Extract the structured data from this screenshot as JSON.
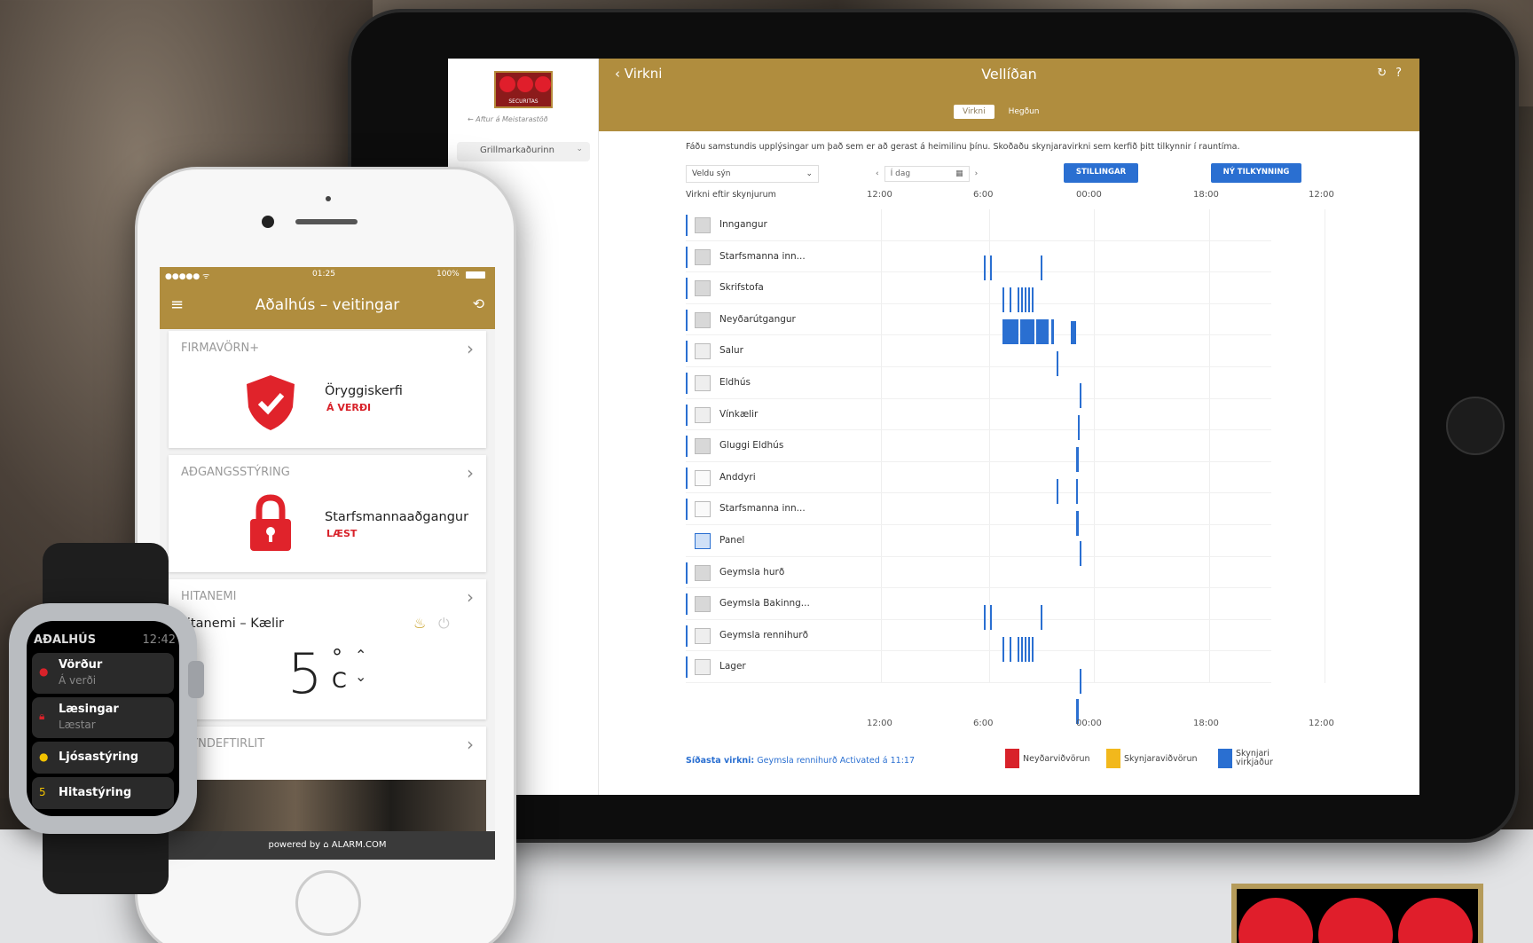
{
  "ipad": {
    "sidebar": {
      "logo_text": "SECURITAS",
      "back_link": "← Aftur á Meistarastöð",
      "site_select": "Grillmarkaðurinn"
    },
    "topbar": {
      "back_label": "Virkni",
      "title": "Vellíðan",
      "tabs": [
        {
          "label": "Virkni",
          "active": true
        },
        {
          "label": "Hegðun",
          "active": false
        }
      ]
    },
    "intro_text": "Fáðu samstundis upplýsingar um það sem er að gerast á heimilinu þínu. Skoðaðu skynjaravirkni sem kerfið þitt tilkynnir í rauntíma.",
    "view_select": "Veldu sýn",
    "date_value": "Í dag",
    "buttons": {
      "settings": "STILLINGAR",
      "new_notification": "NÝ TILKYNNING"
    },
    "sensors_title": "Virkni eftir skynjurum",
    "axis_labels": [
      "12:00",
      "6:00",
      "00:00",
      "18:00",
      "12:00"
    ],
    "sensors": [
      {
        "name": "Inngangur"
      },
      {
        "name": "Starfsmanna inn..."
      },
      {
        "name": "Skrifstofa"
      },
      {
        "name": "Neyðarútgangur"
      },
      {
        "name": "Salur"
      },
      {
        "name": "Eldhús"
      },
      {
        "name": "Vínkælir"
      },
      {
        "name": "Gluggi Eldhús"
      },
      {
        "name": "Anddyri"
      },
      {
        "name": "Starfsmanna inn..."
      },
      {
        "name": "Panel"
      },
      {
        "name": "Geymsla hurð"
      },
      {
        "name": "Geymsla Bakinng..."
      },
      {
        "name": "Geymsla rennihurð"
      },
      {
        "name": "Lager"
      }
    ],
    "last_activity": {
      "label": "Síðasta virkni:",
      "value": "Geymsla rennihurð Activated á 11:17"
    },
    "legend": [
      {
        "label": "Neyðarviðvörun",
        "color": "#d8222a"
      },
      {
        "label": "Skynjaraviðvörun",
        "color": "#f2b81c"
      },
      {
        "label": "Skynjari virkjaður",
        "color": "#2a6fd1"
      }
    ]
  },
  "phone": {
    "status": {
      "carrier": "●●●●● ᯤ",
      "time": "01:25",
      "battery": "100%"
    },
    "title": "Aðalhús – veitingar",
    "cards": {
      "security": {
        "header": "FIRMAVÖRN+",
        "label": "Öryggiskerfi",
        "state": "Á VERÐI"
      },
      "access": {
        "header": "AÐGANGSSTÝRING",
        "label": "Starfsmannaaðgangur",
        "state": "LÆST"
      },
      "temp": {
        "header": "HITANEMI",
        "label": "Hitanemi – Kælir",
        "value": "5",
        "unit_deg": "°",
        "unit_c": "C"
      },
      "camera": {
        "header": "MYNDEFTIRLIT"
      }
    },
    "footer": "powered by ⌂ ALARM.COM"
  },
  "watch": {
    "title": "AÐALHÚS",
    "time": "12:42",
    "items": [
      {
        "title": "Vörður",
        "sub": "Á verði",
        "icon_color": "#d8222a"
      },
      {
        "title": "Læsingar",
        "sub": "Læstar",
        "icon_color": "#d8222a"
      },
      {
        "title": "Ljósastýring",
        "sub": "",
        "icon_color": "#f2c200"
      },
      {
        "title": "Hitastýring",
        "sub": "",
        "icon_value": "5"
      }
    ]
  }
}
